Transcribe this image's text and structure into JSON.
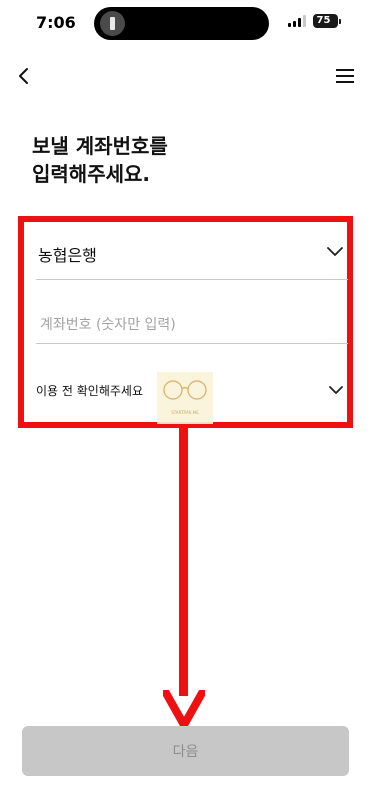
{
  "status_bar": {
    "time": "7:06",
    "battery_percent": "75",
    "signal_bars_filled": 3
  },
  "header": {
    "back_icon": "chevron-left-icon",
    "menu_icon": "hamburger-menu-icon"
  },
  "title": {
    "line1": "보낼 계좌번호를",
    "line2": "입력해주세요."
  },
  "form": {
    "bank_select_value": "농협은행",
    "account_placeholder": "계좌번호 (숫자만 입력)",
    "account_value": "",
    "notice_label": "이용 전 확인해주세요"
  },
  "watermark": {
    "icon": "glasses-icon",
    "text": "STARTRAK.ME"
  },
  "annotation": {
    "highlight_color": "#ef1111"
  },
  "footer": {
    "next_label": "다음"
  },
  "colors": {
    "disabled_button_bg": "#c7c7c7",
    "disabled_button_text": "#8d8d8d"
  }
}
